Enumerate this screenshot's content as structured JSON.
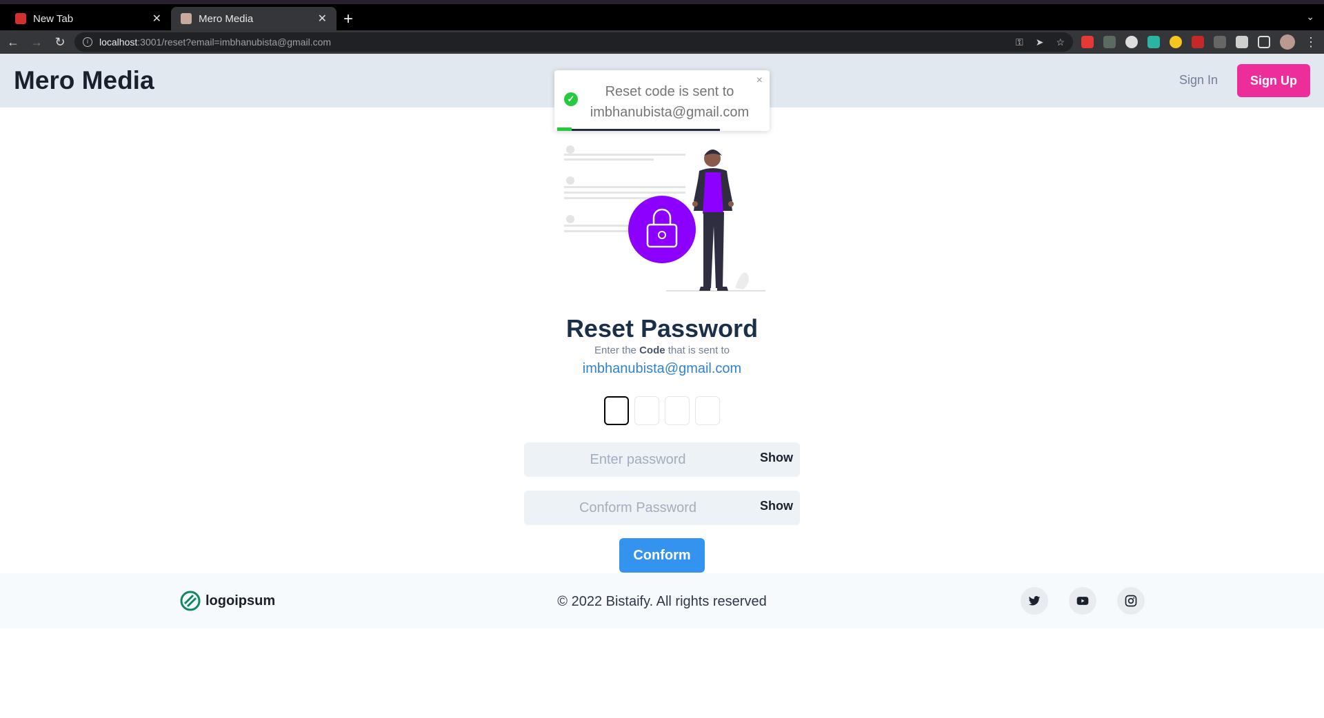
{
  "browser": {
    "tabs": [
      {
        "title": "New Tab",
        "active": false
      },
      {
        "title": "Mero Media",
        "active": true
      }
    ],
    "url_host": "localhost",
    "url_rest": ":3001/reset?email=imbhanubista@gmail.com"
  },
  "header": {
    "brand": "Mero Media",
    "signin": "Sign In",
    "signup": "Sign Up"
  },
  "toast": {
    "message": "Reset code is sent to imbhanubista@gmail.com",
    "close": "×",
    "progress": 0.09
  },
  "form": {
    "title": "Reset Password",
    "subtitle_pre": "Enter the ",
    "subtitle_bold": "Code",
    "subtitle_post": " that is sent to",
    "email": "imbhanubista@gmail.com",
    "pin_count": 4,
    "password_placeholder": "Enter password",
    "confirm_placeholder": "Conform Password",
    "show_label": "Show",
    "submit": "Conform"
  },
  "footer": {
    "logo_text": "logoipsum",
    "copyright": "© 2022 Bistaify. All rights reserved",
    "social": [
      "twitter-icon",
      "youtube-icon",
      "instagram-icon"
    ]
  },
  "colors": {
    "header_bg": "#e2e8f0",
    "signup_bg": "#ed2e9a",
    "accent_purple": "#8b00ff",
    "email_link": "#3182ce",
    "submit_bg": "#3593f0",
    "toast_success": "#27c93f"
  }
}
